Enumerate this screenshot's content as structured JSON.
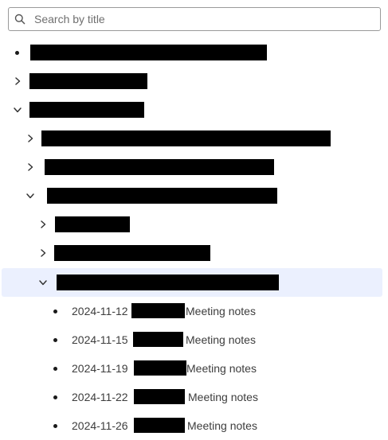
{
  "search": {
    "placeholder": "Search by title",
    "value": ""
  },
  "icons": {
    "search": "search-icon",
    "expand": "chevron-right-icon",
    "collapse": "chevron-down-icon",
    "bullet": "bullet-dot-icon"
  },
  "colors": {
    "selected_row_bg": "#ebf0fe",
    "text": "#3d3d3d",
    "redaction": "#000000"
  },
  "tree": {
    "meeting_items": [
      {
        "date": "2024-11-12",
        "suffix": "Meeting notes"
      },
      {
        "date": "2024-11-15",
        "suffix": "Meeting notes"
      },
      {
        "date": "2024-11-19",
        "suffix": "Meeting notes"
      },
      {
        "date": "2024-11-22",
        "suffix": "Meeting notes"
      },
      {
        "date": "2024-11-26",
        "suffix": "Meeting notes"
      }
    ]
  }
}
